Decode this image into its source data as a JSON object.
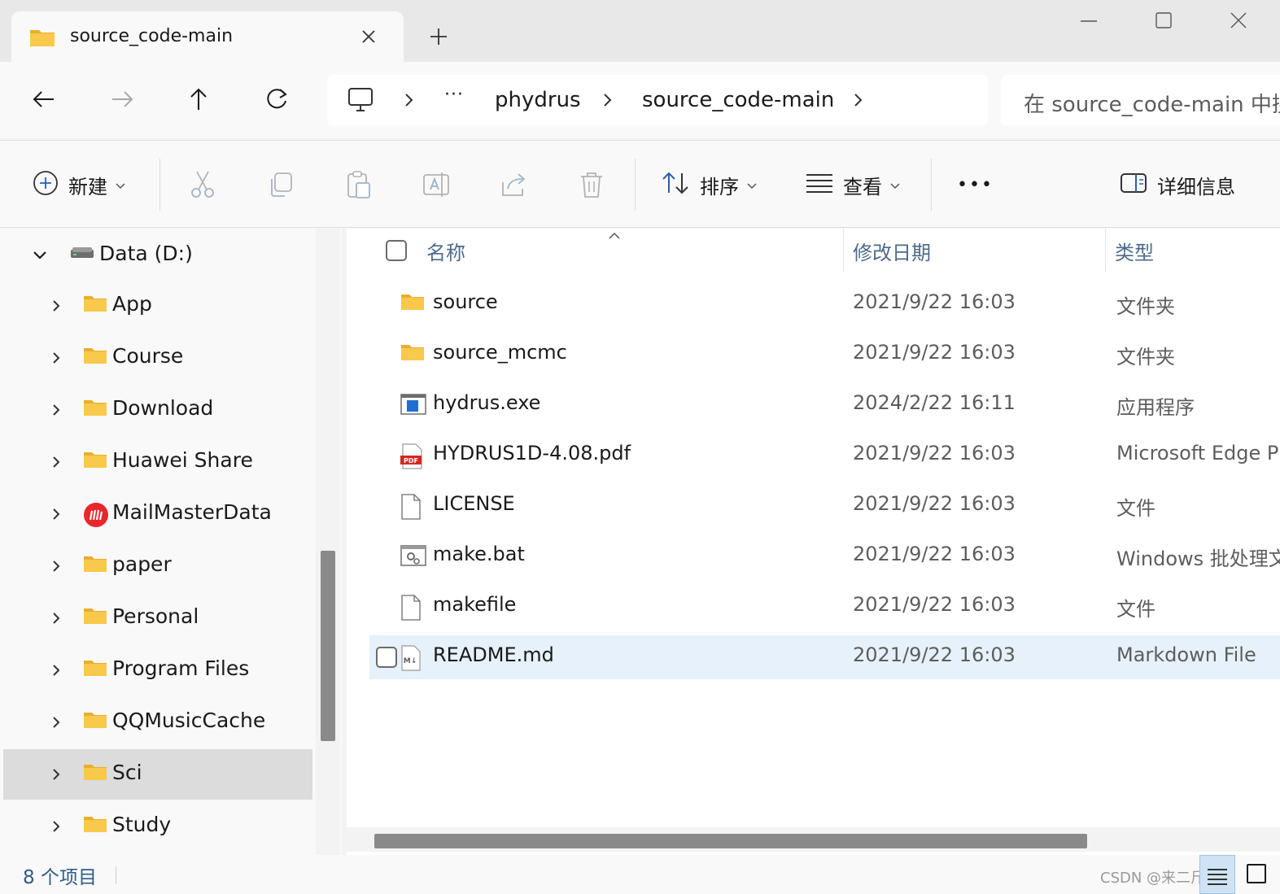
{
  "window": {
    "tab_title": "source_code-main",
    "tab_icon": "folder-icon",
    "new_tab_symbol": "+"
  },
  "nav": {
    "breadcrumbs": [
      "phydrus",
      "source_code-main"
    ],
    "ellipsis": "···",
    "search_placeholder": "在 source_code-main 中搜索"
  },
  "toolbar": {
    "new_label": "新建",
    "sort_label": "排序",
    "view_label": "查看",
    "more_label": "•••",
    "details_label": "详细信息"
  },
  "sidebar": {
    "drive_label": "Data (D:)",
    "items": [
      {
        "label": "App",
        "icon": "folder-icon"
      },
      {
        "label": "Course",
        "icon": "folder-icon"
      },
      {
        "label": "Download",
        "icon": "folder-icon"
      },
      {
        "label": "Huawei Share",
        "icon": "folder-icon"
      },
      {
        "label": "MailMasterData",
        "icon": "mailmaster-icon"
      },
      {
        "label": "paper",
        "icon": "folder-icon"
      },
      {
        "label": "Personal",
        "icon": "folder-icon"
      },
      {
        "label": "Program Files",
        "icon": "folder-icon"
      },
      {
        "label": "QQMusicCache",
        "icon": "folder-icon"
      },
      {
        "label": "Sci",
        "icon": "folder-icon",
        "selected": true
      },
      {
        "label": "Study",
        "icon": "folder-icon"
      }
    ]
  },
  "filelist": {
    "columns": {
      "name": "名称",
      "date": "修改日期",
      "type": "类型"
    },
    "rows": [
      {
        "name": "source",
        "date": "2021/9/22 16:03",
        "type": "文件夹",
        "icon": "folder-icon"
      },
      {
        "name": "source_mcmc",
        "date": "2021/9/22 16:03",
        "type": "文件夹",
        "icon": "folder-icon"
      },
      {
        "name": "hydrus.exe",
        "date": "2024/2/22 16:11",
        "type": "应用程序",
        "icon": "exe-icon"
      },
      {
        "name": "HYDRUS1D-4.08.pdf",
        "date": "2021/9/22 16:03",
        "type": "Microsoft Edge PDF Document",
        "icon": "pdf-icon"
      },
      {
        "name": "LICENSE",
        "date": "2021/9/22 16:03",
        "type": "文件",
        "icon": "file-icon"
      },
      {
        "name": "make.bat",
        "date": "2021/9/22 16:03",
        "type": "Windows 批处理文件",
        "icon": "bat-icon"
      },
      {
        "name": "makefile",
        "date": "2021/9/22 16:03",
        "type": "文件",
        "icon": "file-icon"
      },
      {
        "name": "README.md",
        "date": "2021/9/22 16:03",
        "type": "Markdown File",
        "icon": "markdown-icon",
        "selected": true
      }
    ]
  },
  "status": {
    "item_count": "8 个项目",
    "watermark": "CSDN @来二斤萝卜"
  },
  "colors": {
    "selected_row": "#e6f1fb",
    "selected_tree": "#dcdcdc",
    "folder": "#f8c94a",
    "header_text": "#4d6a8a"
  }
}
